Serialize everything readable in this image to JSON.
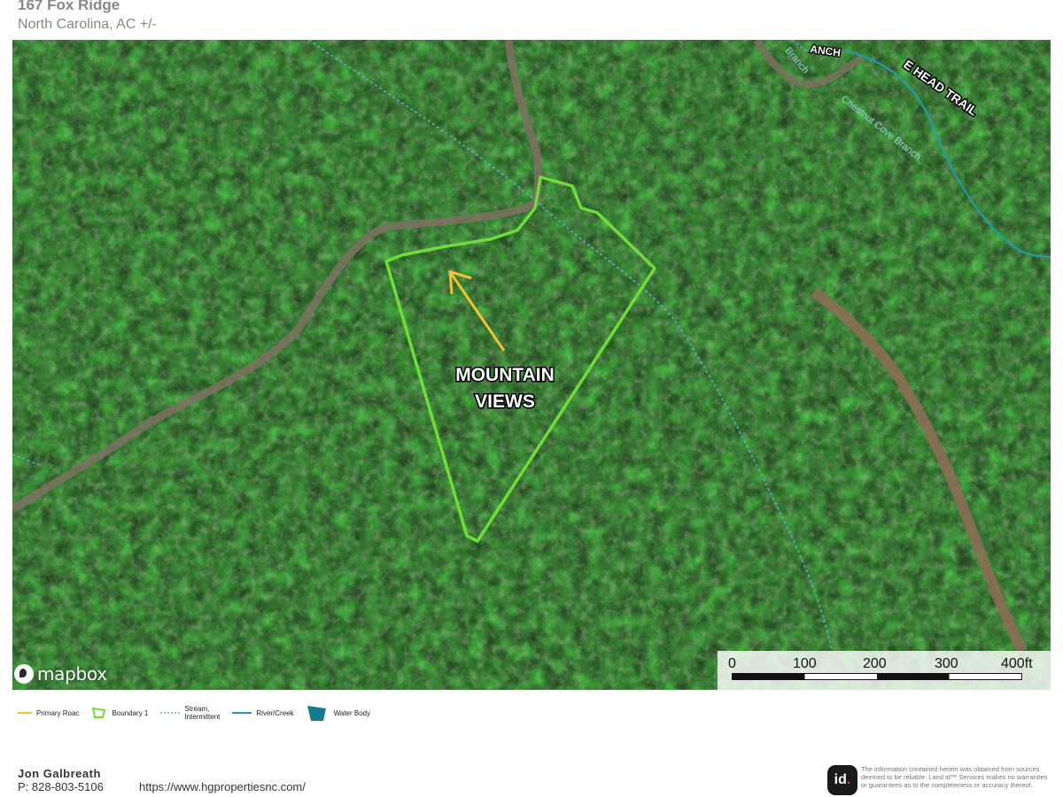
{
  "header": {
    "title": "167 Fox Ridge",
    "subtitle": "North Carolina,  AC +/-"
  },
  "map": {
    "road_labels": [
      "ANCH",
      "E HEAD TRAIL"
    ],
    "stream_labels": [
      "Branch",
      "Chestnut Cove Branch"
    ],
    "annotation": [
      "MOUNTAIN",
      "VIEWS"
    ],
    "attribution": "mapbox",
    "scale_labels": [
      "0",
      "100",
      "200",
      "300",
      "400ft"
    ],
    "colors": {
      "boundary": "#6fdc3a",
      "arrow": "#f2c230",
      "stream": "#58b6c8",
      "river": "#1f9db3",
      "water": "#147c8c"
    }
  },
  "legend": [
    {
      "label": "Primary Roac",
      "icon": "road-line-icon"
    },
    {
      "label": "Boundary 1",
      "icon": "boundary-polygon-icon"
    },
    {
      "label": "Stream,\nIntermittent",
      "icon": "dashed-stream-icon"
    },
    {
      "label": "River/Creek",
      "icon": "river-line-icon"
    },
    {
      "label": "Water Body",
      "icon": "water-body-icon"
    }
  ],
  "footer": {
    "agent_name": "Jon  Galbreath",
    "agent_phone": "P: 828-803-5106",
    "website": "https://www.hgpropertiesnc.com/",
    "badge": "id.",
    "disclaimer": "The information contained herein was obtained from sources deemed to be reliable. Land id™ Services makes no warranties or guarantees as to the completeness or accuracy thereof."
  }
}
